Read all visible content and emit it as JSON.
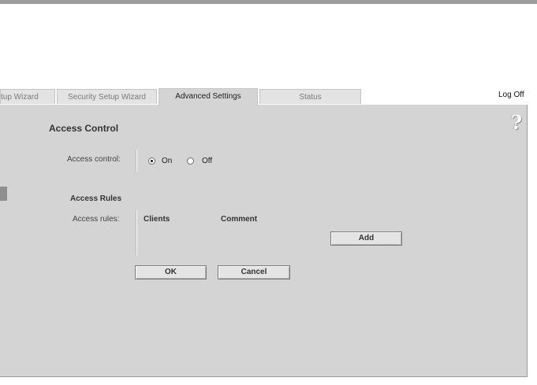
{
  "tabs": [
    {
      "label": "tup Wizard"
    },
    {
      "label": "Security Setup Wizard"
    },
    {
      "label": "Advanced Settings"
    },
    {
      "label": "Status"
    }
  ],
  "header": {
    "logoff_label": "Log Off",
    "help_symbol": "?"
  },
  "access_control": {
    "title": "Access Control",
    "field_label": "Access control:",
    "options": {
      "on": "On",
      "off": "Off"
    },
    "selected": "on"
  },
  "access_rules": {
    "heading": "Access Rules",
    "field_label": "Access rules:",
    "columns": [
      "Clients",
      "Comment"
    ],
    "add_label": "Add"
  },
  "footer": {
    "ok_label": "OK",
    "cancel_label": "Cancel"
  }
}
